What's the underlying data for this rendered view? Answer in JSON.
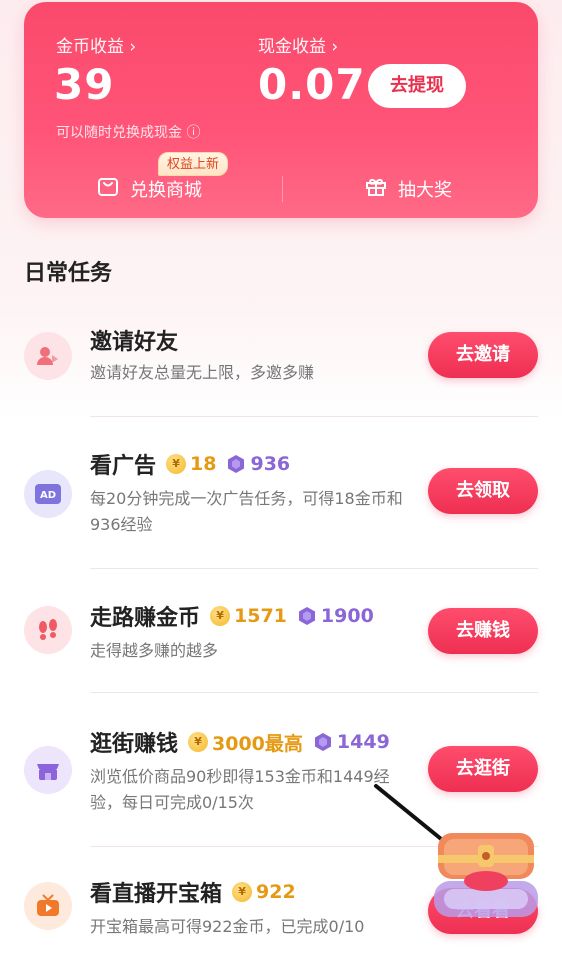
{
  "earnings": {
    "coin_label": "金币收益 ›",
    "coin_value": "39",
    "cash_label": "现金收益 ›",
    "cash_value": "0.07",
    "withdraw_button": "去提现",
    "hint": "可以随时兑换成现金 ⓘ",
    "badge": "权益上新",
    "shop_label": "兑换商城",
    "lottery_label": "抽大奖"
  },
  "section_title": "日常任务",
  "tasks": [
    {
      "title": "邀请好友",
      "desc": "邀请好友总量无上限，多邀多赚",
      "button": "去邀请",
      "icon": "invite-friends-icon"
    },
    {
      "title": "看广告",
      "coin": "18",
      "gem": "936",
      "desc": "每20分钟完成一次广告任务，可得18金币和936经验",
      "button": "去领取",
      "icon": "ad-icon"
    },
    {
      "title": "走路赚金币",
      "coin": "1571",
      "gem": "1900",
      "desc": "走得越多赚的越多",
      "button": "去赚钱",
      "icon": "footprints-icon"
    },
    {
      "title": "逛街赚钱",
      "coin": "3000最高",
      "gem": "1449",
      "desc": "浏览低价商品90秒即得153金币和1449经验，每日可完成0/15次",
      "button": "去逛街",
      "icon": "shop-icon"
    },
    {
      "title": "看直播开宝箱",
      "coin": "922",
      "desc": "开宝箱最高可得922金币，已完成0/10",
      "button": "去看看",
      "icon": "live-tv-icon"
    }
  ],
  "colors": {
    "brand": "#fa4a6b",
    "button": "#ee2f52",
    "coin": "#e69a14",
    "gem": "#8a66d6"
  }
}
